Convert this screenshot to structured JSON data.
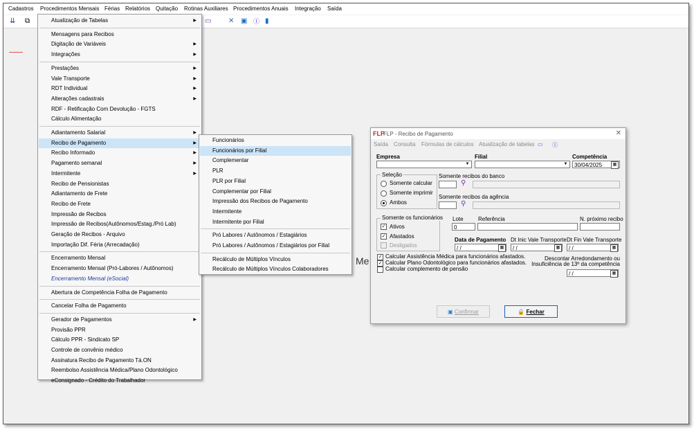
{
  "menubar": [
    "Cadastros",
    "Procedimentos Mensais",
    "Férias",
    "Relatórios",
    "Quitação",
    "Rotinas Auxiliares",
    "Procedimentos Anuais",
    "Integração",
    "Saída"
  ],
  "background_text": "Me",
  "main_menu": [
    {
      "label": "Atualização de Tabelas",
      "arrow": true
    },
    {
      "sep": true
    },
    {
      "label": "Mensagens para Recibos"
    },
    {
      "label": "Digitação de Variáveis",
      "arrow": true
    },
    {
      "label": "Integrações",
      "arrow": true
    },
    {
      "sep": true
    },
    {
      "label": "Prestações",
      "arrow": true
    },
    {
      "label": "Vale Transporte",
      "arrow": true
    },
    {
      "label": "RDT Individual",
      "arrow": true
    },
    {
      "label": "Alterações cadastrais",
      "arrow": true
    },
    {
      "label": "RDF - Retificação Com Devolução - FGTS"
    },
    {
      "label": "Cálculo Alimentação"
    },
    {
      "sep": true
    },
    {
      "label": "Adiantamento Salarial",
      "arrow": true
    },
    {
      "label": "Recibo de Pagamento",
      "arrow": true,
      "state": "hover"
    },
    {
      "label": "Recibo Informado",
      "arrow": true
    },
    {
      "label": "Pagamento semanal",
      "arrow": true
    },
    {
      "label": "Intermitente",
      "arrow": true
    },
    {
      "label": "Recibo de Pensionistas"
    },
    {
      "label": "Adiantamento de Frete"
    },
    {
      "label": "Recibo de Frete"
    },
    {
      "label": "Impressão de Recibos"
    },
    {
      "label": "Impressão de Recibos(Autônomos/Estag./Pró Lab)"
    },
    {
      "label": "Geração de Recibos - Arquivo"
    },
    {
      "label": "Importação Dif. Féria (Arrecadação)"
    },
    {
      "sep": true
    },
    {
      "label": "Encerramento Mensal"
    },
    {
      "label": "Encerramento Mensal (Pró-Labores / Autônomos)"
    },
    {
      "label": "Encerramento Mensal (eSocial)",
      "style": "italic"
    },
    {
      "sep": true
    },
    {
      "label": "Abertura de Competência Folha de Pagamento"
    },
    {
      "sep": true
    },
    {
      "label": "Cancelar Folha de Pagamento"
    },
    {
      "sep": true
    },
    {
      "label": "Gerador de Pagamentos",
      "arrow": true
    },
    {
      "label": "Provisão PPR"
    },
    {
      "label": "Cálculo PPR - Sindicato SP"
    },
    {
      "label": "Controle de convênio médico"
    },
    {
      "label": "Assinatura Recibo de Pagamento Tá.ON"
    },
    {
      "label": "Reembolso Assistência Médica/Plano Odontológico"
    },
    {
      "label": "eConsignado - Crédito do Trabalhador"
    }
  ],
  "sub_menu": [
    {
      "label": "Funcionários"
    },
    {
      "label": "Funcionários por Filial",
      "state": "selected"
    },
    {
      "label": "Complementar"
    },
    {
      "label": "PLR"
    },
    {
      "label": "PLR por Filial"
    },
    {
      "label": "Complementar por Filial"
    },
    {
      "label": "Impressão dos Recibos de Pagamento"
    },
    {
      "label": "Intermitente"
    },
    {
      "label": "Intermitente por Filial"
    },
    {
      "sep": true
    },
    {
      "label": "Pró Labores / Autônomos / Estagiários"
    },
    {
      "label": "Pró Labores / Autônomos / Estagiários por Filial"
    },
    {
      "sep": true
    },
    {
      "label": "Recálculo de Múltiplos Vínculos"
    },
    {
      "label": "Recálculo de Múltiplos Vínculos Colaboradores"
    }
  ],
  "dialog": {
    "logo": "FLP",
    "title": "FLP - Recibo de Pagamento",
    "menu": [
      "Saída",
      "Consulta",
      "Fórmulas de cálculos",
      "Atualização de tabelas"
    ],
    "empresa_label": "Empresa",
    "filial_label": "Filial",
    "competencia_label": "Competência",
    "competencia_value": "30/04/2025",
    "selecao_label": "Seleção",
    "selecao_options": [
      "Somente calcular",
      "Somente imprimir",
      "Ambos"
    ],
    "selecao_selected": "Ambos",
    "banco_label": "Somente recibos do banco",
    "agencia_label": "Somente recibos da agência",
    "funcionarios_label": "Somente os funcionários",
    "func_options": [
      {
        "label": "Ativos",
        "checked": true,
        "enabled": true
      },
      {
        "label": "Afastados",
        "checked": true,
        "enabled": true
      },
      {
        "label": "Desligados",
        "checked": false,
        "enabled": false
      }
    ],
    "lote_label": "Lote",
    "lote_value": "0",
    "referencia_label": "Referência",
    "proximo_label": "N. próximo recibo",
    "data_pagamento_label": "Data de Pagamento",
    "dt_inic_label": "Dt Inic Vale Transporte",
    "dt_fin_label": "Dt Fin Vale Transporte",
    "date_placeholder": " /  / ",
    "checks": [
      {
        "label": "Calcular Assistência Médica para funcionários afastados.",
        "checked": true
      },
      {
        "label": "Calcular Plano Odontológico para funcionários afastados.",
        "checked": true
      },
      {
        "label": "Calcular complemento de pensão",
        "checked": false
      }
    ],
    "descontar_line1": "Descontar Arredondamento ou",
    "descontar_line2": "Insuficiência de 13º da competência",
    "confirm_label": "Confirmar",
    "close_label": "Fechar"
  }
}
